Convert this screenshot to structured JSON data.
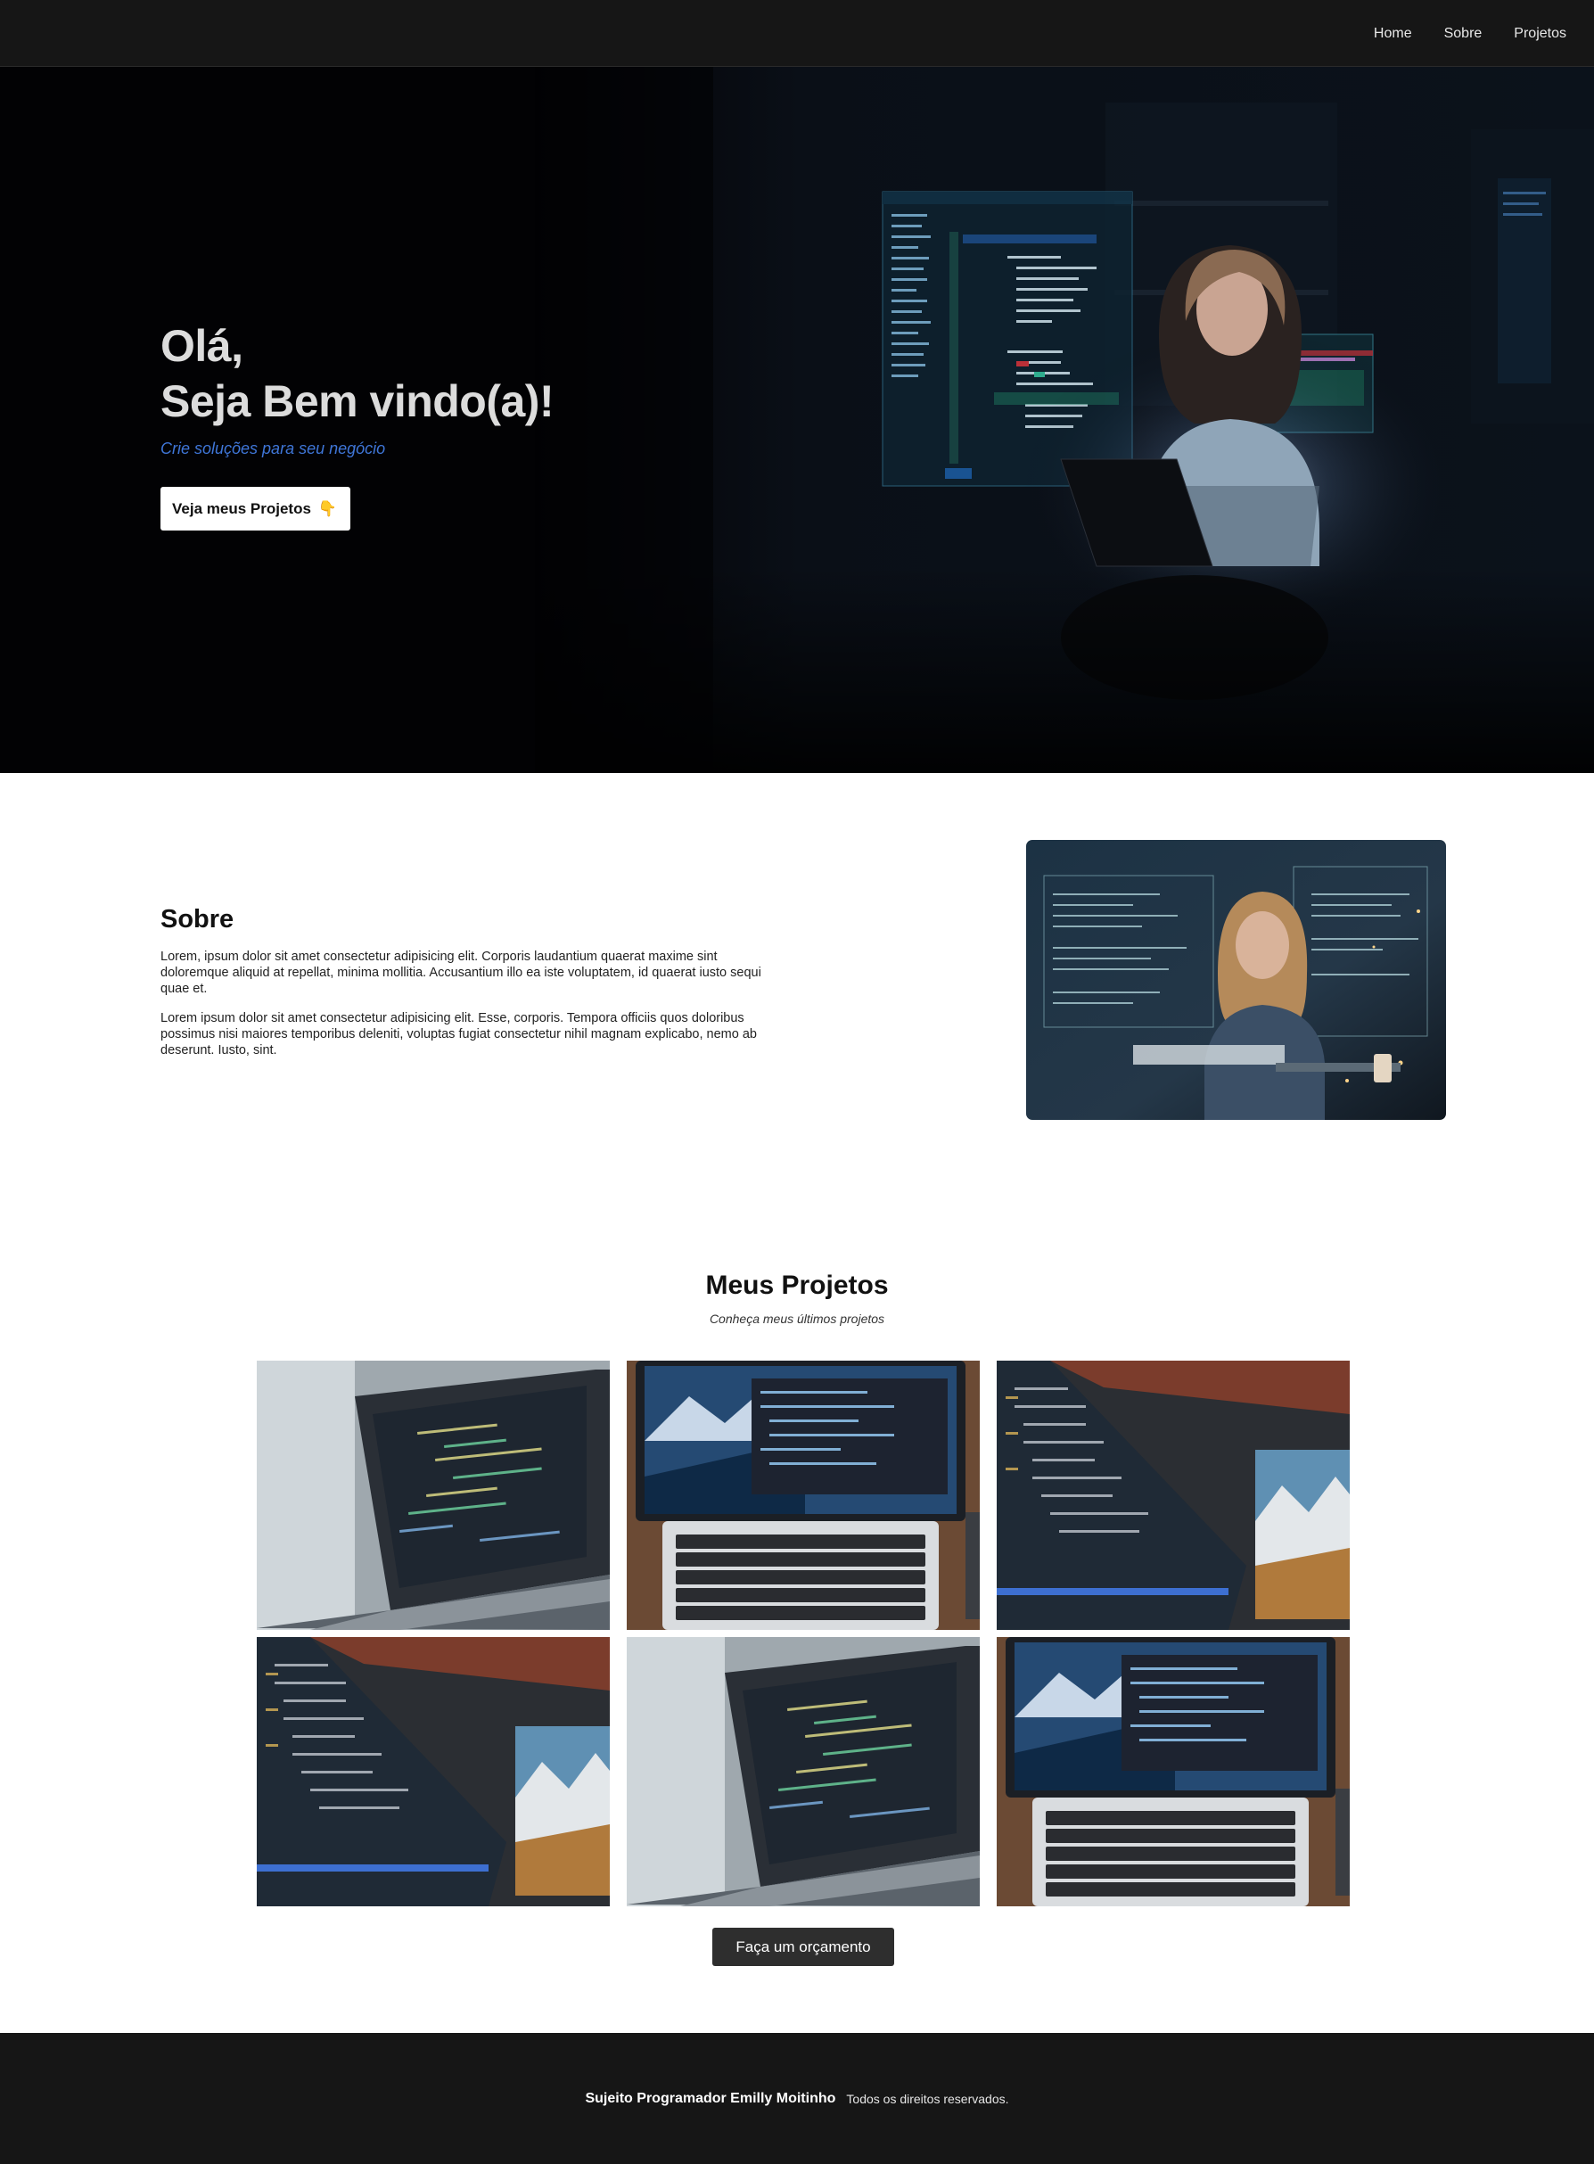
{
  "nav": {
    "links": [
      {
        "label": "Home"
      },
      {
        "label": "Sobre"
      },
      {
        "label": "Projetos"
      }
    ]
  },
  "hero": {
    "title_line1": "Olá,",
    "title_line2": "Seja Bem vindo(a)!",
    "subtitle": "Crie soluções para seu negócio",
    "button_label": "Veja meus Projetos",
    "button_icon": "👇",
    "image_desc_icon": "woman-coding-at-night-image"
  },
  "about": {
    "title": "Sobre",
    "paragraphs": [
      "Lorem, ipsum dolor sit amet consectetur adipisicing elit. Corporis laudantium quaerat maxime sint doloremque aliquid at repellat, minima mollitia. Accusantium illo ea iste voluptatem, id quaerat iusto sequi quae et.",
      "Lorem ipsum dolor sit amet consectetur adipisicing elit. Esse, corporis. Tempora officiis quos doloribus possimus nisi maiores temporibus deleniti, voluptas fugiat consectetur nihil magnam explicabo, nemo ab deserunt. Iusto, sint."
    ]
  },
  "projects": {
    "title": "Meus Projetos",
    "subtitle": "Conheça meus últimos projetos",
    "cta_label": "Faça um orçamento"
  },
  "footer": {
    "name": "Sujeito Programador Emilly Moitinho",
    "rights": "Todos os direitos reservados."
  },
  "colors": {
    "nav_bg": "#161616",
    "hero_bg": "#020204",
    "accent_blue": "#3f76d8",
    "cta_bg": "#2e2e2e"
  }
}
